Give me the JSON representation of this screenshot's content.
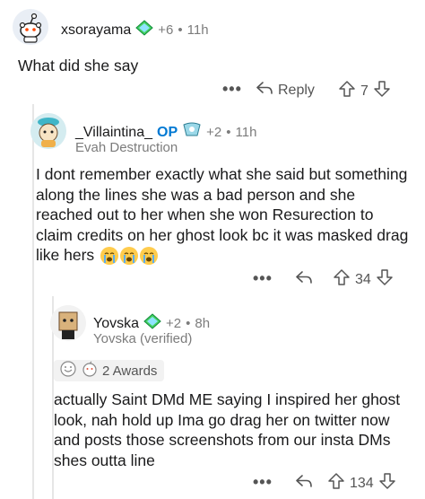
{
  "comments": [
    {
      "user": "xsorayama",
      "score_extra": "+6",
      "time": "11h",
      "text": "What did she say",
      "reply_label": "Reply",
      "votes": "7"
    },
    {
      "user": "_Villaintina_",
      "op_label": "OP",
      "score_extra": "+2",
      "time": "11h",
      "flair": "Evah Destruction",
      "text": "I dont remember exactly what she said but something along the lines she was a bad person and she reached out to her when she won Resurection to claim credits on her ghost look bc it was masked drag like hers",
      "votes": "34"
    },
    {
      "user": "Yovska",
      "score_extra": "+2",
      "time": "8h",
      "flair": "Yovska (verified)",
      "awards_label": "2 Awards",
      "text": "actually Saint DMd ME saying I inspired her ghost look, nah hold up Ima go drag her on twitter now and posts those screenshots from our insta DMs shes outta line",
      "votes": "134"
    }
  ],
  "separator": "•",
  "more_label": "•••",
  "colors": {
    "op": "#0079d3",
    "thread_line": "#e6e6e6",
    "muted": "#7c7c7c"
  }
}
